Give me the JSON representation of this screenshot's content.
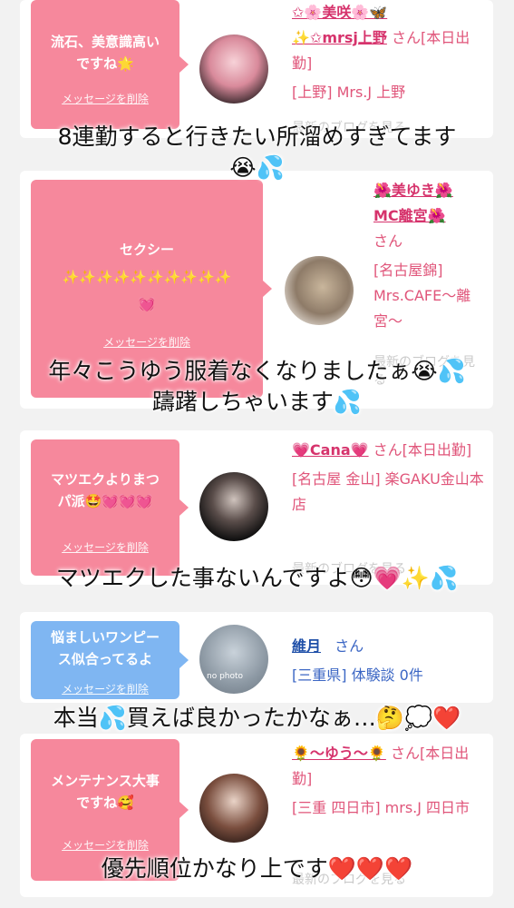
{
  "cards": [
    {
      "message": "流石、美意識高い\nですね🌟",
      "delete_label": "メッセージを削除",
      "name": "✩🌸美咲🌸🦋\n✨✩mrsj上野",
      "san": "さん[本日出勤]",
      "shop": "[上野] Mrs.J 上野",
      "blog": "最新のブログを見る"
    },
    {
      "message": "セクシー\n✨✨✨✨✨✨✨✨✨✨\n💓",
      "delete_label": "メッセージを削除",
      "name": "🌺美ゆき🌺\nMC離宮🌺",
      "san": "さん",
      "shop": "[名古屋錦] Mrs.CAFE〜離宮〜",
      "blog": "最新のブログを見る"
    },
    {
      "message": "マツエクよりまつ\nパ派🤩💓💓💓",
      "delete_label": "メッセージを削除",
      "name": "💗Cana💗",
      "san": "さん[本日出勤]",
      "shop": "[名古屋 金山] 楽GAKU金山本店",
      "blog": "最新のブログを見る"
    },
    {
      "message": "悩ましいワンピー\nス似合ってるよ",
      "delete_label": "メッセージを削除",
      "name": "維月",
      "san": "さん",
      "shop": "[三重県] 体験談 0件",
      "nophoto": "no photo"
    },
    {
      "message": "メンテナンス大事\nですね🥰",
      "delete_label": "メッセージを削除",
      "name": "🌻〜ゆう〜🌻",
      "san": "さん[本日出勤]",
      "shop": "[三重 四日市] mrs.J 四日市",
      "blog": "最新のブログを見る"
    }
  ],
  "captions": [
    "8連勤すると行きたい所溜めすぎてます\n😭💦",
    "年々こうゆう服着なくなりましたぁ😭💦\n躊躇しちゃいます💦",
    "マツエクした事ないんですよ😳💗✨💦",
    "本当💦買えば良かったかなぁ…🤔💭❤️",
    "優先順位かなり上です❤️❤️❤️"
  ],
  "colors": {
    "bubble_pink": "#f6889c",
    "bubble_blue": "#7fb6f2",
    "name_pink": "#d6336c",
    "text_pink": "#e0557a",
    "background": "#f2f2f2"
  }
}
